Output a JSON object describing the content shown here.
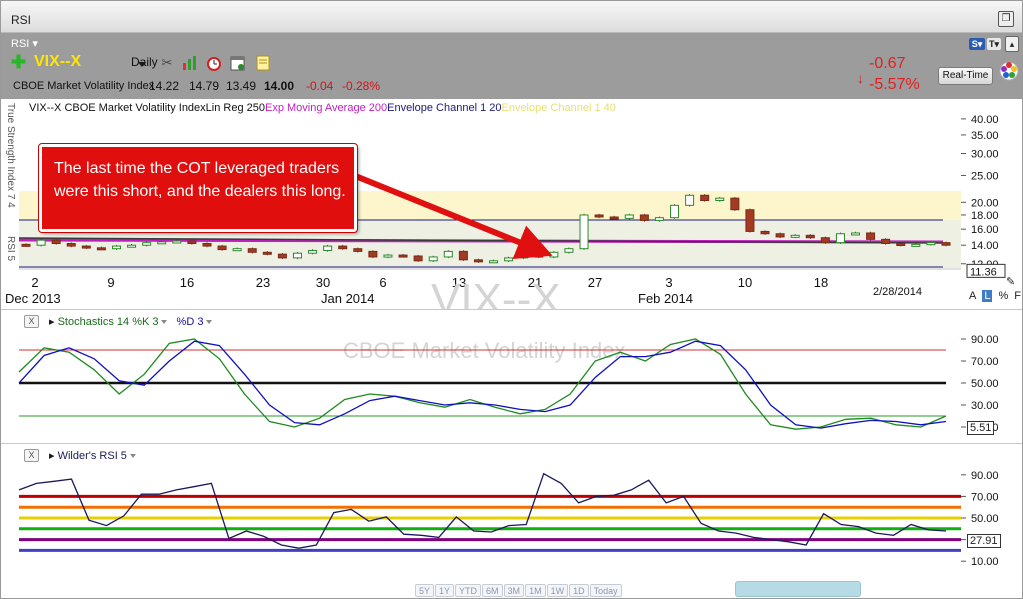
{
  "window": {
    "title": "RSI"
  },
  "toolbar": {
    "rsi_menu": "RSI ▾",
    "symbol": "VIX--X",
    "period": "Daily",
    "quote_name": "CBOE Market Volatility Index",
    "open": "14.22",
    "high": "14.79",
    "low": "13.49",
    "close": "14.00",
    "change": "-0.04",
    "change_pct": "-0.28%",
    "big_change": "-0.67",
    "big_change_pct": "-5.57%",
    "realtime_label": "Real-Time",
    "tools": [
      "crosshair-icon",
      "bar-chart-icon",
      "alarm-clock-icon",
      "calendar-icon",
      "notes-icon"
    ]
  },
  "price_panel": {
    "side_label": "True Strength Index 7 4",
    "side_label2": "RSI 5",
    "legend": [
      {
        "text": "VIX--X CBOE Market Volatility Index",
        "color": "#111111"
      },
      {
        "text": "Lin Reg 250",
        "color": "#111111"
      },
      {
        "text": "Exp Moving Average 200",
        "color": "#c020c0"
      },
      {
        "text": "Envelope Channel 1 20",
        "color": "#1a1a7a"
      },
      {
        "text": "Envelope Channel 1 40",
        "color": "#e8e070"
      }
    ],
    "y_ticks": [
      "40.00",
      "35.00",
      "30.00",
      "25.00",
      "20.00",
      "18.00",
      "16.00",
      "14.00",
      "12.00"
    ],
    "last_value": "11.36",
    "x_labels": [
      "2",
      "9",
      "16",
      "23",
      "30",
      "6",
      "13",
      "21",
      "27",
      "3",
      "10",
      "18"
    ],
    "month_labels": [
      "Dec 2013",
      "Jan 2014",
      "Feb 2014"
    ],
    "date_label": "2/28/2014",
    "scale_options": [
      "A",
      "L",
      "%",
      "F"
    ],
    "watermark_symbol": "VIX--X",
    "watermark_name": "CBOE Market Volatility Index"
  },
  "callout": {
    "text": "The last time the COT leveraged traders were this short, and the dealers this long."
  },
  "stoch_panel": {
    "close_label": "X",
    "legend": "Stochastics 14 %K 3",
    "legend2": "%D 3",
    "y_ticks": [
      "90.00",
      "70.00",
      "50.00",
      "30.00",
      "10.00"
    ],
    "last_value": "5.51"
  },
  "rsi_panel": {
    "close_label": "X",
    "legend": "Wilder's RSI 5",
    "y_ticks": [
      "90.00",
      "70.00",
      "50.00",
      "30.00",
      "10.00"
    ],
    "last_value": "27.91",
    "level_colors": [
      "#c00000",
      "#f07000",
      "#e8d000",
      "#10b010",
      "#800080",
      "#4040c0"
    ]
  },
  "range_buttons": [
    "5Y",
    "1Y",
    "YTD",
    "6M",
    "3M",
    "1M",
    "1W",
    "1D",
    "Today"
  ],
  "chart_data": [
    {
      "type": "candlestick",
      "title": "VIX--X CBOE Market Volatility Index",
      "x": [
        "Dec 2",
        "Dec 9",
        "Dec 16",
        "Dec 23",
        "Dec 30",
        "Jan 6",
        "Jan 13",
        "Jan 21",
        "Jan 27",
        "Feb 3",
        "Feb 10",
        "Feb 18",
        "Feb 28"
      ],
      "close": [
        14.0,
        13.6,
        14.2,
        13.5,
        13.0,
        13.5,
        12.4,
        12.7,
        18.0,
        21.0,
        15.5,
        14.0,
        14.0
      ],
      "last": 11.36,
      "ylim": [
        11,
        40
      ],
      "log_scale": true
    },
    {
      "type": "line",
      "title": "Stochastics 14 %K 3 %D 3",
      "series": [
        {
          "name": "%K",
          "values": [
            60,
            82,
            78,
            62,
            40,
            58,
            86,
            90,
            72,
            40,
            15,
            10,
            18,
            35,
            40,
            38,
            32,
            28,
            35,
            28,
            22,
            26,
            40,
            70,
            78,
            70,
            85,
            90,
            76,
            40,
            12,
            8,
            10,
            17,
            18,
            12,
            10,
            20
          ]
        },
        {
          "name": "%D",
          "values": [
            50,
            75,
            82,
            72,
            52,
            48,
            70,
            88,
            84,
            58,
            30,
            14,
            12,
            22,
            34,
            38,
            34,
            30,
            32,
            30,
            26,
            24,
            30,
            55,
            74,
            74,
            78,
            88,
            84,
            62,
            30,
            12,
            9,
            13,
            16,
            15,
            12,
            15
          ]
        }
      ],
      "levels": [
        80,
        50,
        20
      ],
      "ylim": [
        0,
        100
      ],
      "last": 5.51
    },
    {
      "type": "line",
      "title": "Wilder's RSI 5",
      "series": [
        {
          "name": "RSI",
          "values": [
            76,
            82,
            84,
            86,
            48,
            43,
            52,
            72,
            72,
            76,
            79,
            82,
            31,
            38,
            33,
            25,
            22,
            25,
            55,
            58,
            47,
            51,
            35,
            34,
            32,
            51,
            38,
            37,
            43,
            44,
            91,
            82,
            64,
            70,
            71,
            76,
            85,
            64,
            70,
            45,
            38,
            36,
            32,
            30,
            28,
            25,
            54,
            44,
            42,
            36,
            34,
            44,
            39,
            38
          ]
        }
      ],
      "levels": [
        70,
        60,
        50,
        40,
        30,
        20
      ],
      "ylim": [
        0,
        100
      ],
      "last": 27.91
    }
  ]
}
